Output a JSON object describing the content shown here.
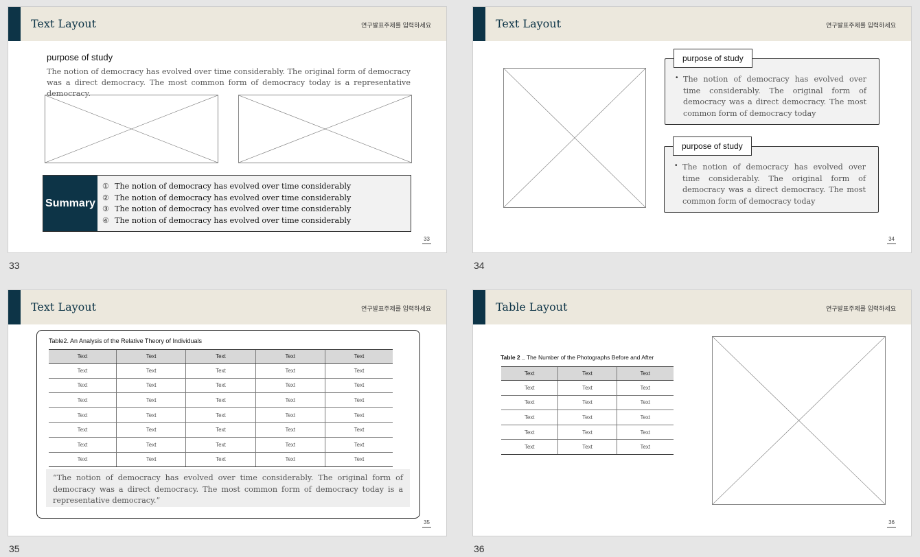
{
  "header_subtitle": "연구발표주제를 입력하세요",
  "slides": [
    {
      "number": "33",
      "page_number": "33",
      "title": "Text Layout",
      "heading": "purpose of study",
      "body": "The notion of democracy has evolved over time considerably. The original form of democracy was a direct democracy. The most common form of democracy today is a representative democracy.",
      "summary": {
        "label": "Summary",
        "items": [
          {
            "marker": "①",
            "text": "The notion of democracy has evolved over time considerably"
          },
          {
            "marker": "②",
            "text": "The notion of democracy has evolved over time considerably"
          },
          {
            "marker": "③",
            "text": "The notion of democracy has evolved over time considerably"
          },
          {
            "marker": "④",
            "text": "The notion of democracy has evolved over time considerably"
          }
        ]
      }
    },
    {
      "number": "34",
      "page_number": "34",
      "title": "Text Layout",
      "callouts": [
        {
          "tab": "purpose of study",
          "bullet": "•",
          "text": "The notion of democracy has evolved over time considerably. The original form of democracy was a direct democracy. The most common form of democracy today"
        },
        {
          "tab": "purpose of study",
          "bullet": "•",
          "text": "The notion of democracy has evolved over time considerably. The original form of democracy was a direct democracy. The most common form of democracy today"
        }
      ]
    },
    {
      "number": "35",
      "page_number": "35",
      "title": "Text Layout",
      "table_caption": "Table2. An Analysis of the Relative Theory of Individuals",
      "table": {
        "headers": [
          "Text",
          "Text",
          "Text",
          "Text",
          "Text"
        ],
        "rows": [
          [
            "Text",
            "Text",
            "Text",
            "Text",
            "Text"
          ],
          [
            "Text",
            "Text",
            "Text",
            "Text",
            "Text"
          ],
          [
            "Text",
            "Text",
            "Text",
            "Text",
            "Text"
          ],
          [
            "Text",
            "Text",
            "Text",
            "Text",
            "Text"
          ],
          [
            "Text",
            "Text",
            "Text",
            "Text",
            "Text"
          ],
          [
            "Text",
            "Text",
            "Text",
            "Text",
            "Text"
          ],
          [
            "Text",
            "Text",
            "Text",
            "Text",
            "Text"
          ]
        ]
      },
      "quote": "“The notion of democracy has evolved over time considerably. The original form of democracy was a direct democracy. The most common form of democracy today is a representative democracy.”"
    },
    {
      "number": "36",
      "page_number": "36",
      "title": "Table Layout",
      "table_caption_prefix": "Table 2 _",
      "table_caption": "The Number of the Photographs Before and After",
      "table": {
        "headers": [
          "Text",
          "Text",
          "Text"
        ],
        "rows": [
          [
            "Text",
            "Text",
            "Text"
          ],
          [
            "Text",
            "Text",
            "Text"
          ],
          [
            "Text",
            "Text",
            "Text"
          ],
          [
            "Text",
            "Text",
            "Text"
          ],
          [
            "Text",
            "Text",
            "Text"
          ]
        ]
      }
    }
  ],
  "colors": {
    "accent": "#0d3447",
    "header_bg": "#ece8dd",
    "panel_bg": "#f2f2f2",
    "canvas_bg": "#e6e6e6"
  },
  "icons": {
    "placeholder": "image-placeholder-icon"
  }
}
